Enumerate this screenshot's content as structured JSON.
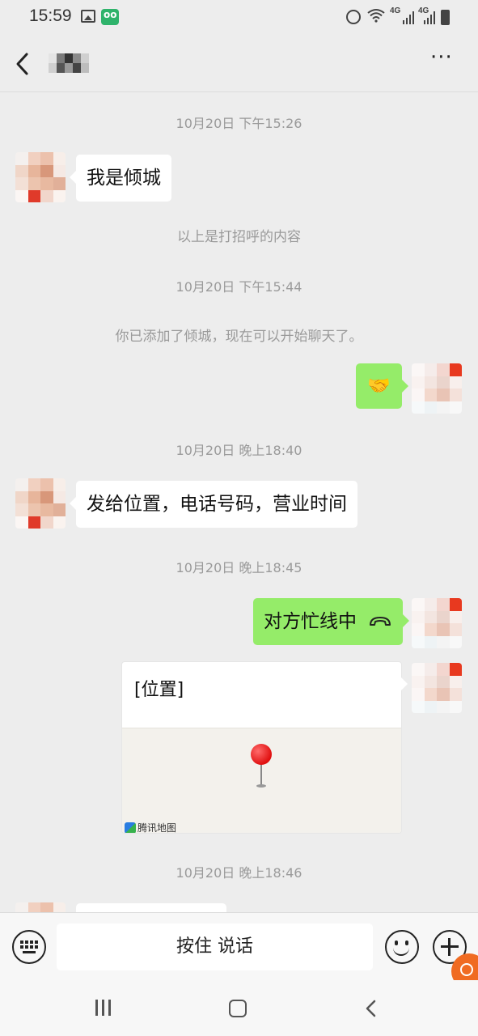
{
  "status_bar": {
    "time": "15:59",
    "network_1": "4G",
    "network_2": "4G",
    "icons": [
      "image-icon",
      "app-notification-icon",
      "alarm-icon",
      "wifi-icon",
      "signal-icon",
      "signal-icon",
      "battery-icon"
    ]
  },
  "header": {
    "contact_name_pixelated": true,
    "icons": [
      "back-icon",
      "more-icon"
    ]
  },
  "messages": [
    {
      "type": "time",
      "text": "10月20日 下午15:26"
    },
    {
      "type": "bubble",
      "side": "left",
      "text": "我是倾城"
    },
    {
      "type": "system",
      "text": "以上是打招呼的内容"
    },
    {
      "type": "time",
      "text": "10月20日 下午15:44"
    },
    {
      "type": "system",
      "text": "你已添加了倾城，现在可以开始聊天了。"
    },
    {
      "type": "bubble",
      "side": "right",
      "emoji": "🤝"
    },
    {
      "type": "time",
      "text": "10月20日 晚上18:40"
    },
    {
      "type": "bubble",
      "side": "left",
      "text": "发给位置，电话号码，营业时间"
    },
    {
      "type": "time",
      "text": "10月20日 晚上18:45"
    },
    {
      "type": "bubble",
      "side": "right",
      "text": "对方忙线中",
      "icon": "hangup-icon"
    },
    {
      "type": "location",
      "side": "right",
      "title": "[位置]",
      "provider": "腾讯地图"
    },
    {
      "type": "time",
      "text": "10月20日 晚上18:46"
    }
  ],
  "input_bar": {
    "talk_label": "按住 说话",
    "icons": [
      "keyboard-icon",
      "emoji-icon",
      "plus-icon"
    ]
  },
  "colors": {
    "background": "#ededed",
    "right_bubble": "#95ec69",
    "left_bubble": "#ffffff",
    "timestamp": "#9a9a9a"
  }
}
